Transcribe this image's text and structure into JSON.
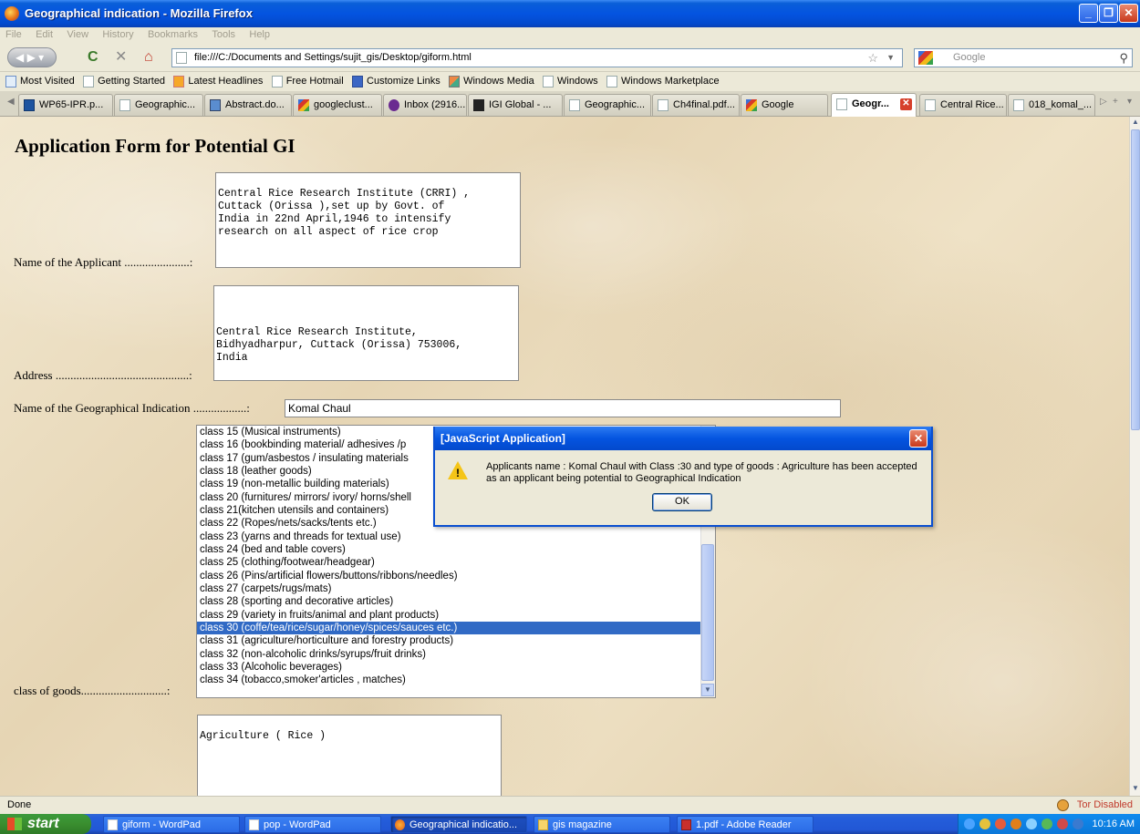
{
  "window": {
    "title": "Geographical indication - Mozilla Firefox",
    "controls": [
      "minimize",
      "maximize",
      "close"
    ]
  },
  "menu": [
    "File",
    "Edit",
    "View",
    "History",
    "Bookmarks",
    "Tools",
    "Help"
  ],
  "nav": {
    "url": "file:///C:/Documents and Settings/sujit_gis/Desktop/giform.html",
    "search_placeholder": "Google"
  },
  "bookmarks": [
    {
      "label": "Most Visited",
      "icon": "most-visited-icon"
    },
    {
      "label": "Getting Started",
      "icon": "page-icon"
    },
    {
      "label": "Latest Headlines",
      "icon": "rss-icon"
    },
    {
      "label": "Free Hotmail",
      "icon": "page-icon"
    },
    {
      "label": "Customize Links",
      "icon": "msn-icon"
    },
    {
      "label": "Windows Media",
      "icon": "windows-media-icon"
    },
    {
      "label": "Windows",
      "icon": "page-icon"
    },
    {
      "label": "Windows Marketplace",
      "icon": "page-icon"
    }
  ],
  "tabs": [
    {
      "label": "WP65-IPR.p...",
      "icon": "tn"
    },
    {
      "label": "Geographic...",
      "icon": "page"
    },
    {
      "label": "Abstract.do...",
      "icon": "ab"
    },
    {
      "label": "googleclust...",
      "icon": "g"
    },
    {
      "label": "Inbox (2916...",
      "icon": "y"
    },
    {
      "label": "IGI Global - ...",
      "icon": "igi"
    },
    {
      "label": "Geographic...",
      "icon": "page"
    },
    {
      "label": "Ch4final.pdf...",
      "icon": "page"
    },
    {
      "label": "Google",
      "icon": "g"
    },
    {
      "label": "Geogr...",
      "icon": "page",
      "active": true
    },
    {
      "label": "Central Rice...",
      "icon": "page"
    },
    {
      "label": "018_komal_...",
      "icon": "page"
    }
  ],
  "form": {
    "title": "Application Form for Potential GI",
    "applicant_label": "Name of the Applicant ......................:",
    "applicant_value": "\nCentral Rice Research Institute (CRRI) ,\nCuttack (Orissa ),set up by Govt. of\nIndia in 22nd April,1946 to intensify\nresearch on all aspect of rice crop",
    "address_label": "Address .............................................:",
    "address_value": "\n\n\nCentral Rice Research Institute,\nBidhyadharpur, Cuttack (Orissa) 753006,\nIndia",
    "gi_name_label": "Name of the Geographical Indication ..................:",
    "gi_name_value": "Komal Chaul",
    "class_label": "class of goods.............................:",
    "class_options": [
      "class 15 (Musical instruments)",
      "class 16 (bookbinding material/ adhesives /p",
      "class 17 (gum/asbestos / insulating materials",
      "class 18 (leather goods)",
      "class 19 (non-metallic building materials)",
      "class 20 (furnitures/ mirrors/ ivory/ horns/shell",
      "class 21(kitchen utensils and containers)",
      "class 22 (Ropes/nets/sacks/tents etc.)",
      "class 23 (yarns and threads for textual use)",
      "class 24 (bed and table covers)",
      "class 25 (clothing/footwear/headgear)",
      "class 26 (Pins/artificial flowers/buttons/ribbons/needles)",
      "class 27 (carpets/rugs/mats)",
      "class 28 (sporting and decorative articles)",
      "class 29 (variety in fruits/animal and plant products)",
      "class 30 (coffe/tea/rice/sugar/honey/spices/sauces etc.)",
      "class 31 (agriculture/horticulture and forestry products)",
      "class 32 (non-alcoholic drinks/syrups/fruit drinks)",
      "class 33 (Alcoholic beverages)",
      "class 34 (tobacco,smoker'articles , matches)"
    ],
    "selected_class": "class 30 (coffe/tea/rice/sugar/honey/spices/sauces etc.)",
    "goods_type_value": "\nAgriculture ( Rice )"
  },
  "dialog": {
    "title": "[JavaScript Application]",
    "message": "Applicants name : Komal Chaul with Class :30 and type of goods : Agriculture has been accepted as an applicant being potential to Geographical Indication",
    "ok_label": "OK"
  },
  "status": {
    "left": "Done",
    "right": "Tor Disabled"
  },
  "taskbar": {
    "start": "start",
    "tasks": [
      {
        "label": "giform - WordPad",
        "icon": "doc"
      },
      {
        "label": "pop - WordPad",
        "icon": "doc"
      },
      {
        "label": "Geographical indicatio...",
        "icon": "ff",
        "active": true
      },
      {
        "label": "gis magazine",
        "icon": "folder"
      },
      {
        "label": "1.pdf - Adobe Reader",
        "icon": "pdf"
      }
    ],
    "time": "10:16 AM"
  },
  "colors": {
    "selection": "#316ac5",
    "titlebar": "#0454e0",
    "taskbar": "#245edb"
  }
}
